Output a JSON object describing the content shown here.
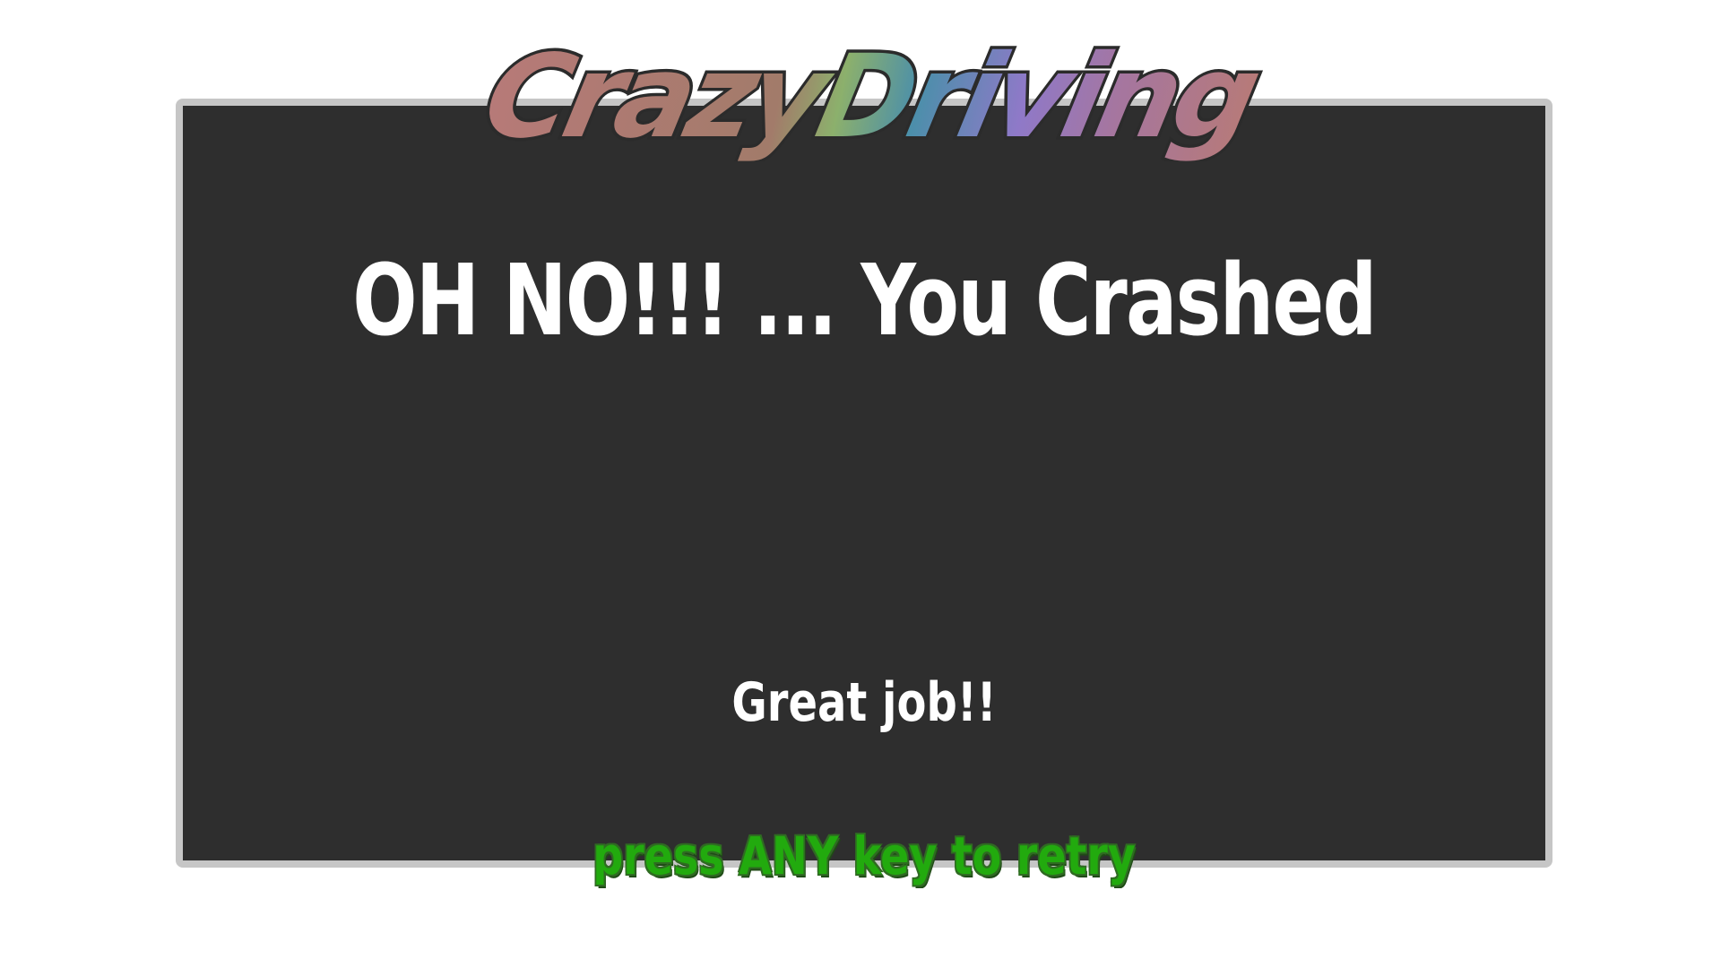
{
  "logo": {
    "word1": "Crazy",
    "word2": "Driving",
    "colors": [
      "#b37775",
      "#7fae6a",
      "#4f8fa8",
      "#8e78c8",
      "#b37775"
    ]
  },
  "screen": {
    "headline": "OH NO!!! ... You Crashed",
    "message": "Great job!!",
    "prompt": "press ANY key to retry"
  },
  "colors": {
    "panel_background": "#2e2e2e",
    "panel_border": "#c6c6c6",
    "prompt_text": "#22aa0e",
    "text": "#ffffff"
  }
}
